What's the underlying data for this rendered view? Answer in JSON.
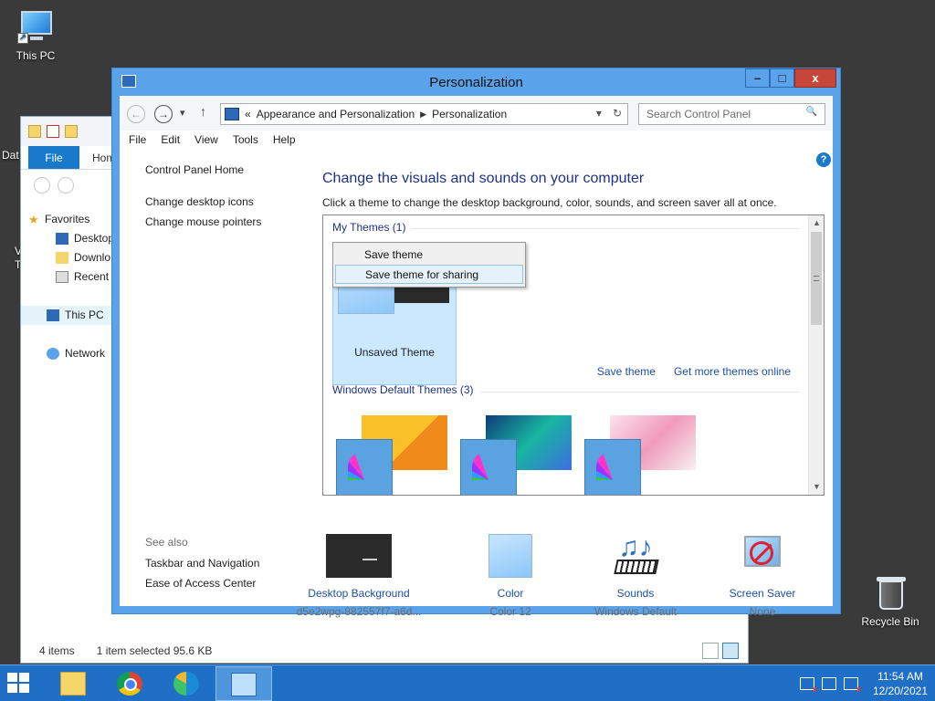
{
  "desktop": {
    "this_pc_label": "This PC",
    "recycle_bin_label": "Recycle Bin",
    "edge_fragments": [
      "Dat",
      "V",
      "T"
    ]
  },
  "explorer": {
    "tabs": [
      "File",
      "Hom"
    ],
    "tree": [
      {
        "label": "Favorites",
        "icon": "star-icon"
      },
      {
        "label": "Desktop",
        "icon": "desktop-folder-icon"
      },
      {
        "label": "Downlo",
        "icon": "downloads-folder-icon"
      },
      {
        "label": "Recent p",
        "icon": "recent-places-icon"
      },
      {
        "label": "This PC",
        "icon": "computer-icon"
      },
      {
        "label": "Network",
        "icon": "network-icon"
      }
    ],
    "status": {
      "items": "4 items",
      "selection": "1 item selected  95.6 KB"
    }
  },
  "window": {
    "title": "Personalization",
    "controls": {
      "minimize": "–",
      "maximize": "□",
      "close": "x"
    },
    "nav": {
      "back": "←",
      "forward": "→",
      "recent": "▾",
      "up": "↑"
    },
    "breadcrumb": {
      "overflow": "«",
      "items": [
        "Appearance and Personalization",
        "Personalization"
      ],
      "separator": "▶",
      "dropdown": "▾",
      "refresh": "↻"
    },
    "search": {
      "placeholder": "Search Control Panel",
      "icon": "🔍"
    },
    "menu": [
      "File",
      "Edit",
      "View",
      "Tools",
      "Help"
    ],
    "left_nav": {
      "home": "Control Panel Home",
      "links": [
        "Change desktop icons",
        "Change mouse pointers"
      ]
    },
    "see_also": {
      "header": "See also",
      "links": [
        "Taskbar and Navigation",
        "Ease of Access Center"
      ]
    },
    "help_icon": "?",
    "heading": "Change the visuals and sounds on your computer",
    "subheading": "Click a theme to change the desktop background, color, sounds, and screen saver all at once.",
    "themes": {
      "my_themes_title": "My Themes (1)",
      "unsaved_theme_label": "Unsaved Theme",
      "links": [
        "Save theme",
        "Get more themes online"
      ],
      "default_title": "Windows Default Themes (3)",
      "default_themes": [
        {
          "name": "windows-theme",
          "bg": "#f6b324"
        },
        {
          "name": "lines-theme",
          "bg": "#1a9e8a"
        },
        {
          "name": "flowers-theme",
          "bg": "#f3c6d8"
        }
      ]
    },
    "context_menu": [
      "Save theme",
      "Save theme for sharing"
    ],
    "bottom": [
      {
        "label": "Desktop Background",
        "sub": "d5e2wpg-882557f7-a6d..."
      },
      {
        "label": "Color",
        "sub": "Color 12"
      },
      {
        "label": "Sounds",
        "sub": "Windows Default"
      },
      {
        "label": "Screen Saver",
        "sub": "None"
      }
    ]
  },
  "taskbar": {
    "apps": [
      "File Explorer",
      "Google Chrome",
      "Microsoft Edge",
      "Control Panel"
    ],
    "clock": {
      "time": "11:54 AM",
      "date": "12/20/2021"
    }
  },
  "colors": {
    "accent": "#5aa3ea",
    "taskbar": "#1f6fc6",
    "link": "#1e50a2",
    "heading": "#1e3287"
  }
}
